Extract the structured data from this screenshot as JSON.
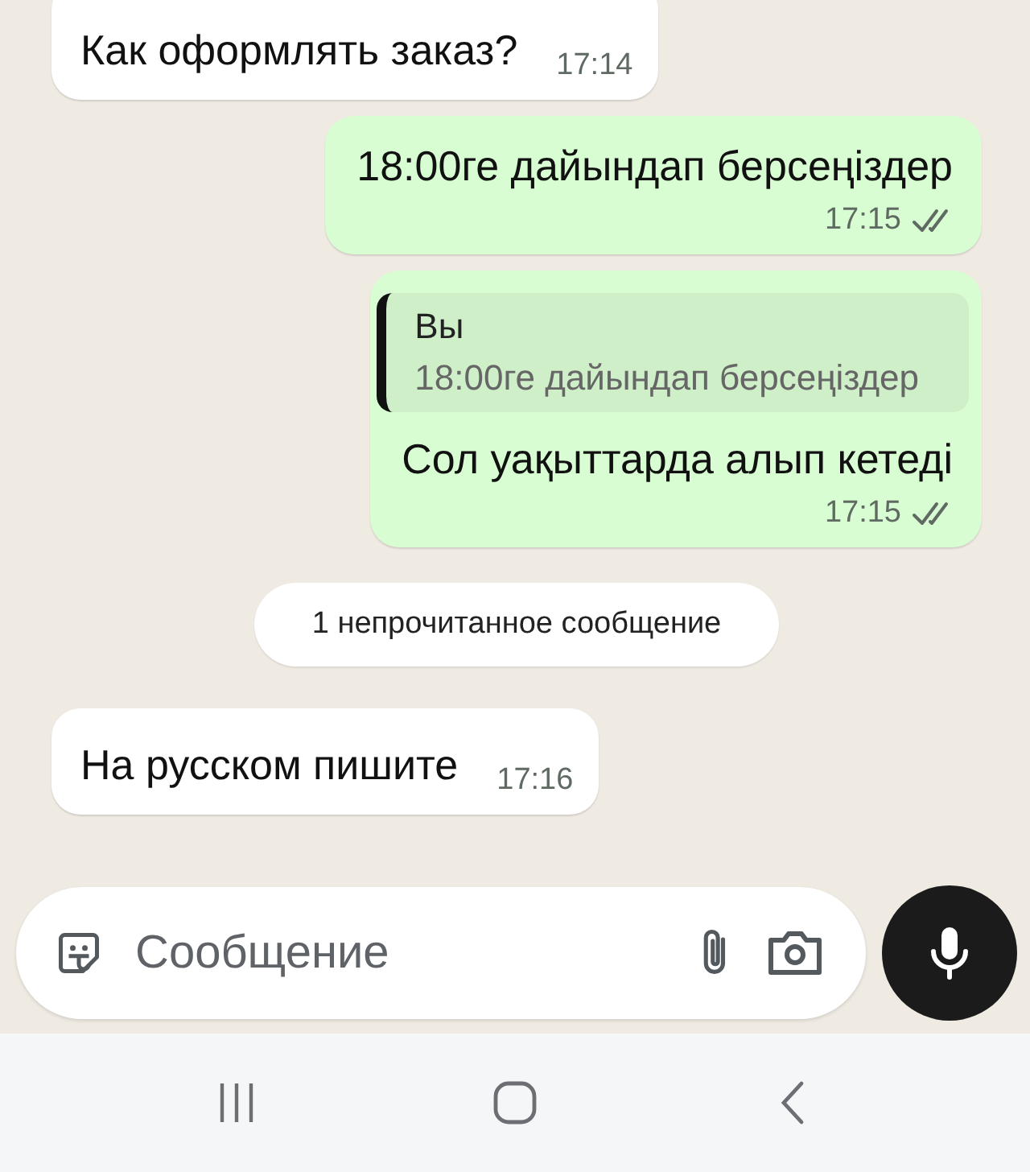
{
  "messages": [
    {
      "kind": "incoming",
      "text": "Как оформлять заказ?",
      "time": "17:14"
    },
    {
      "kind": "outgoing",
      "text": "18:00ге дайындап берсеңіздер",
      "time": "17:15",
      "read": false
    },
    {
      "kind": "outgoing",
      "reply": {
        "author": "Вы",
        "text": "18:00ге дайындап берсеңіздер"
      },
      "text": "Сол уақыттарда алып кетеді",
      "time": "17:15",
      "read": false
    },
    {
      "kind": "system",
      "text": "1 непрочитанное сообщение"
    },
    {
      "kind": "incoming",
      "text": "На русском пишите",
      "time": "17:16"
    }
  ],
  "composer": {
    "placeholder": "Сообщение"
  }
}
